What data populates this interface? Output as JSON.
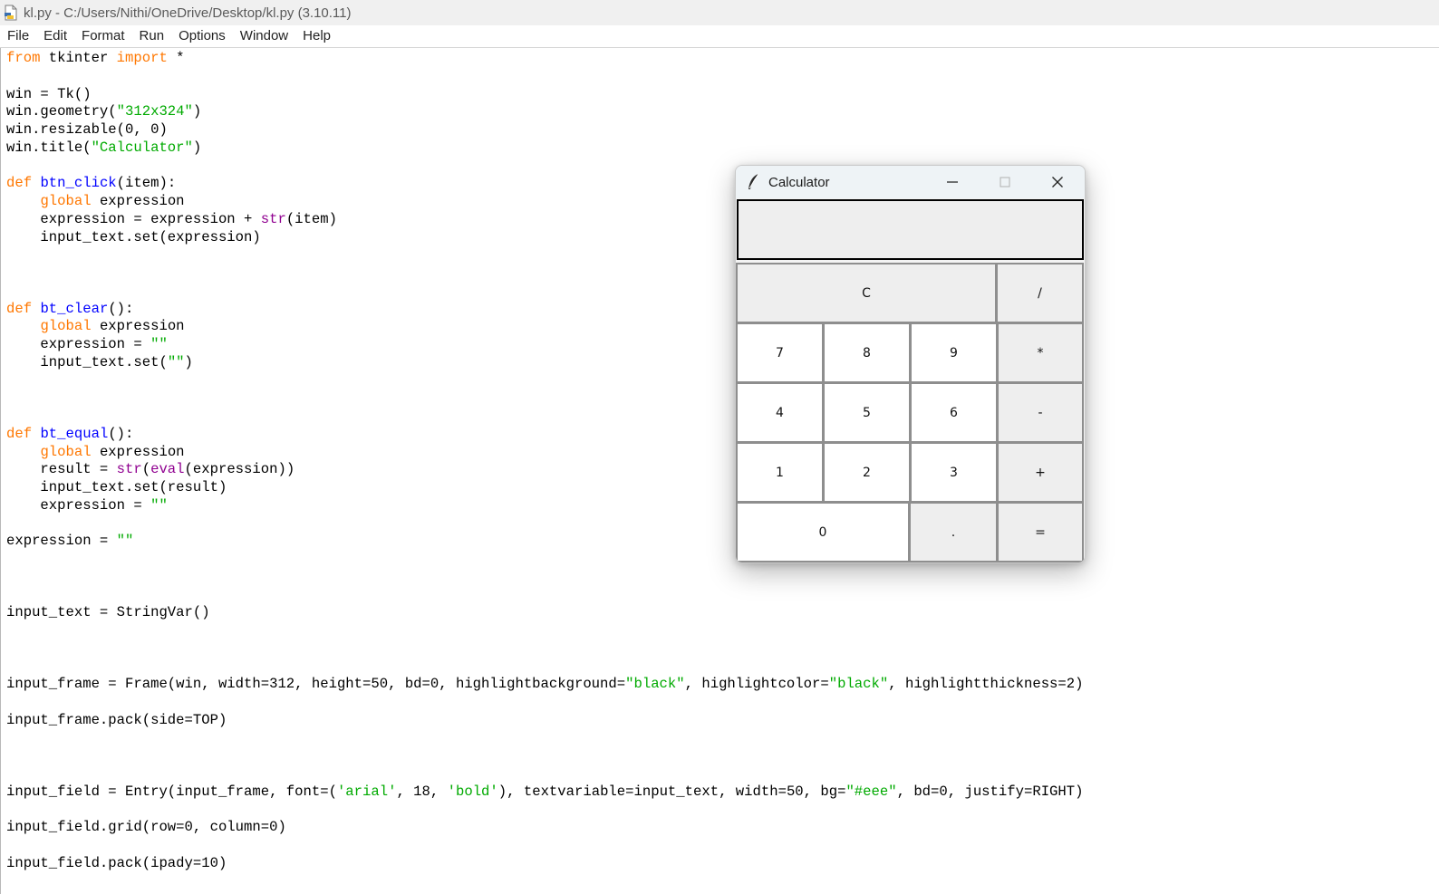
{
  "window": {
    "title": "kl.py - C:/Users/Nithi/OneDrive/Desktop/kl.py (3.10.11)"
  },
  "menu": [
    "File",
    "Edit",
    "Format",
    "Run",
    "Options",
    "Window",
    "Help"
  ],
  "code_lines": [
    [
      {
        "t": "from",
        "c": "kw"
      },
      {
        "t": " tkinter "
      },
      {
        "t": "import",
        "c": "kw"
      },
      {
        "t": " *"
      }
    ],
    [],
    [
      {
        "t": "win = Tk()"
      }
    ],
    [
      {
        "t": "win.geometry("
      },
      {
        "t": "\"312x324\"",
        "c": "st"
      },
      {
        "t": ")"
      }
    ],
    [
      {
        "t": "win.resizable(0, 0)"
      }
    ],
    [
      {
        "t": "win.title("
      },
      {
        "t": "\"Calculator\"",
        "c": "st"
      },
      {
        "t": ")"
      }
    ],
    [],
    [
      {
        "t": "def",
        "c": "kw"
      },
      {
        "t": " "
      },
      {
        "t": "btn_click",
        "c": "fn"
      },
      {
        "t": "(item):"
      }
    ],
    [
      {
        "t": "    "
      },
      {
        "t": "global",
        "c": "kw"
      },
      {
        "t": " expression"
      }
    ],
    [
      {
        "t": "    expression = expression + "
      },
      {
        "t": "str",
        "c": "bi"
      },
      {
        "t": "(item)"
      }
    ],
    [
      {
        "t": "    input_text.set(expression)"
      }
    ],
    [],
    [],
    [],
    [
      {
        "t": "def",
        "c": "kw"
      },
      {
        "t": " "
      },
      {
        "t": "bt_clear",
        "c": "fn"
      },
      {
        "t": "():"
      }
    ],
    [
      {
        "t": "    "
      },
      {
        "t": "global",
        "c": "kw"
      },
      {
        "t": " expression"
      }
    ],
    [
      {
        "t": "    expression = "
      },
      {
        "t": "\"\"",
        "c": "st"
      }
    ],
    [
      {
        "t": "    input_text.set("
      },
      {
        "t": "\"\"",
        "c": "st"
      },
      {
        "t": ")"
      }
    ],
    [],
    [],
    [],
    [
      {
        "t": "def",
        "c": "kw"
      },
      {
        "t": " "
      },
      {
        "t": "bt_equal",
        "c": "fn"
      },
      {
        "t": "():"
      }
    ],
    [
      {
        "t": "    "
      },
      {
        "t": "global",
        "c": "kw"
      },
      {
        "t": " expression"
      }
    ],
    [
      {
        "t": "    result = "
      },
      {
        "t": "str",
        "c": "bi"
      },
      {
        "t": "("
      },
      {
        "t": "eval",
        "c": "bi"
      },
      {
        "t": "(expression))"
      }
    ],
    [
      {
        "t": "    input_text.set(result)"
      }
    ],
    [
      {
        "t": "    expression = "
      },
      {
        "t": "\"\"",
        "c": "st"
      }
    ],
    [],
    [
      {
        "t": "expression = "
      },
      {
        "t": "\"\"",
        "c": "st"
      }
    ],
    [],
    [],
    [],
    [
      {
        "t": "input_text = StringVar()"
      }
    ],
    [],
    [],
    [],
    [
      {
        "t": "input_frame = Frame(win, width=312, height=50, bd=0, highlightbackground="
      },
      {
        "t": "\"black\"",
        "c": "st"
      },
      {
        "t": ", highlightcolor="
      },
      {
        "t": "\"black\"",
        "c": "st"
      },
      {
        "t": ", highlightthickness=2)"
      }
    ],
    [],
    [
      {
        "t": "input_frame.pack(side=TOP)"
      }
    ],
    [],
    [],
    [],
    [
      {
        "t": "input_field = Entry(input_frame, font=("
      },
      {
        "t": "'arial'",
        "c": "st"
      },
      {
        "t": ", 18, "
      },
      {
        "t": "'bold'",
        "c": "st"
      },
      {
        "t": "), textvariable=input_text, width=50, bg="
      },
      {
        "t": "\"#eee\"",
        "c": "st"
      },
      {
        "t": ", bd=0, justify=RIGHT)"
      }
    ],
    [],
    [
      {
        "t": "input_field.grid(row=0, column=0)"
      }
    ],
    [],
    [
      {
        "t": "input_field.pack(ipady=10)"
      }
    ]
  ],
  "calculator": {
    "title": "Calculator",
    "display_value": "",
    "buttons": [
      {
        "label": "C",
        "name": "clear-button",
        "style": "grey"
      },
      {
        "label": "/",
        "name": "divide-button",
        "style": "grey"
      },
      {
        "label": "7",
        "name": "seven-button",
        "style": "white"
      },
      {
        "label": "8",
        "name": "eight-button",
        "style": "white"
      },
      {
        "label": "9",
        "name": "nine-button",
        "style": "white"
      },
      {
        "label": "*",
        "name": "multiply-button",
        "style": "grey"
      },
      {
        "label": "4",
        "name": "four-button",
        "style": "white"
      },
      {
        "label": "5",
        "name": "five-button",
        "style": "white"
      },
      {
        "label": "6",
        "name": "six-button",
        "style": "white"
      },
      {
        "label": "-",
        "name": "minus-button",
        "style": "grey"
      },
      {
        "label": "1",
        "name": "one-button",
        "style": "white"
      },
      {
        "label": "2",
        "name": "two-button",
        "style": "white"
      },
      {
        "label": "3",
        "name": "three-button",
        "style": "white"
      },
      {
        "label": "+",
        "name": "plus-button",
        "style": "grey"
      },
      {
        "label": "0",
        "name": "zero-button",
        "style": "white"
      },
      {
        "label": ".",
        "name": "decimal-button",
        "style": "grey"
      },
      {
        "label": "=",
        "name": "equals-button",
        "style": "grey"
      }
    ]
  },
  "colors": {
    "keyword": "#ff7700",
    "function_name": "#0000ff",
    "string": "#00aa00",
    "builtin": "#900090"
  }
}
